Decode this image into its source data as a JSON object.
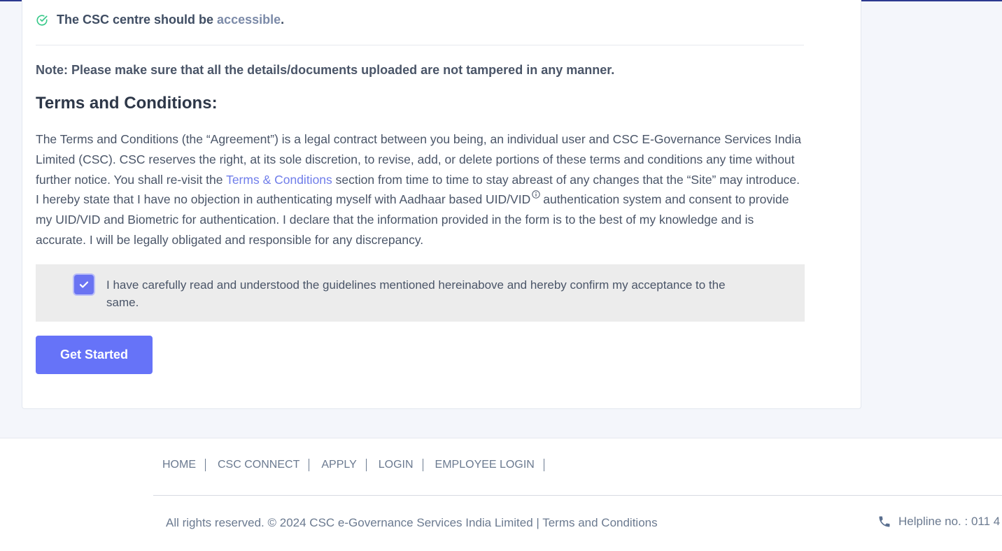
{
  "guideline": {
    "prefix": "The CSC centre should be ",
    "highlight": "accessible",
    "suffix": "."
  },
  "note": "Note: Please make sure that all the details/documents uploaded are not tampered in any manner.",
  "terms": {
    "heading": "Terms and Conditions:",
    "body_part1": "The Terms and Conditions (the “Agreement”) is a legal contract between you being, an individual user and CSC E-Governance Services India Limited (CSC). CSC reserves the right, at its sole discretion, to revise, add, or delete portions of these terms and conditions any time without further notice. You shall re-visit the ",
    "link_label": "Terms & Conditions",
    "body_part2": " section from time to time to stay abreast of any changes that the “Site” may introduce. I hereby state that I have no objection in authenticating myself with Aadhaar based UID/VID",
    "body_part3": "authentication system and consent to provide my UID/VID and Biometric for authentication. I declare that the information provided in the form is to the best of my knowledge and is accurate. I will be legally obligated and responsible for any discrepancy."
  },
  "acceptance": {
    "checked": true,
    "label": "I have carefully read and understood the guidelines mentioned hereinabove and hereby confirm my acceptance to the same."
  },
  "get_started_label": "Get Started",
  "footer": {
    "nav": [
      "HOME",
      "CSC CONNECT",
      "APPLY",
      "LOGIN",
      "EMPLOYEE LOGIN"
    ],
    "copyright": "All rights reserved. © 2024 CSC e-Governance Services India Limited | Terms and Conditions",
    "helpline": "Helpline no. : 011 4"
  },
  "colors": {
    "primary": "#6673f8",
    "check_green": "#38c98a",
    "link": "#6f7dea",
    "accent_rule": "#2b3990"
  }
}
